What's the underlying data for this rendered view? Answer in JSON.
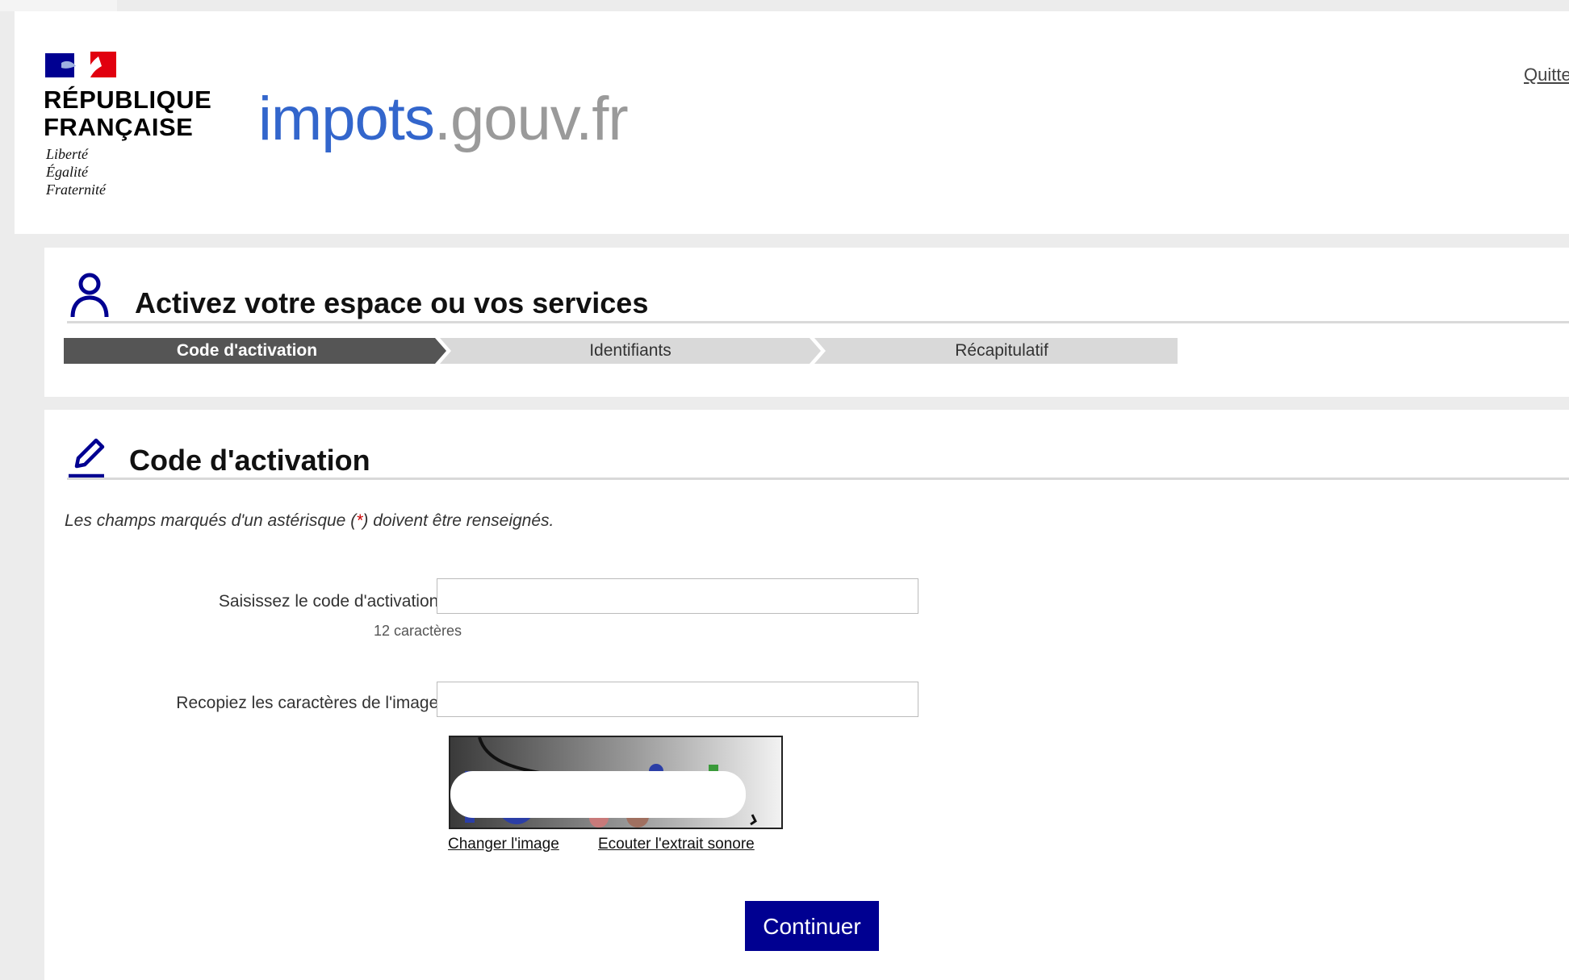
{
  "header": {
    "republic_line1": "RÉPUBLIQUE",
    "republic_line2": "FRANÇAISE",
    "motto": [
      "Liberté",
      "Égalité",
      "Fraternité"
    ],
    "site_name_part1": "impots",
    "site_name_part2": ".gouv.fr",
    "quit_label": "Quitte"
  },
  "page": {
    "title": "Activez votre espace ou vos services",
    "steps": [
      {
        "label": "Code d'activation",
        "state": "active"
      },
      {
        "label": "Identifiants",
        "state": "inactive"
      },
      {
        "label": "Récapitulatif",
        "state": "inactive"
      }
    ]
  },
  "section": {
    "title": "Code d'activation",
    "required_hint_before": "Les champs marqués d'un astérisque (",
    "required_hint_mark": "*",
    "required_hint_after": ") doivent être renseignés.",
    "fields": [
      {
        "label": "Saisissez le code d'activation :",
        "required_mark": "*",
        "sublabel": "12 caractères",
        "value": ""
      },
      {
        "label": "Recopiez les caractères de l'image :",
        "required_mark": "*",
        "value": ""
      }
    ],
    "captcha_links": {
      "change": "Changer l'image",
      "audio": "Ecouter l'extrait sonore"
    },
    "continue_label": "Continuer"
  },
  "colors": {
    "brand_blue": "#000091",
    "site_blue": "#3366cc",
    "site_grey": "#9a9a9a",
    "marianne_red": "#e1000f",
    "step_active": "#555555",
    "step_inactive": "#d9d9d9",
    "required_red": "#cc0000"
  },
  "icons": {
    "user": "user-icon",
    "pencil": "pencil-icon",
    "logo": "marianne-logo"
  }
}
